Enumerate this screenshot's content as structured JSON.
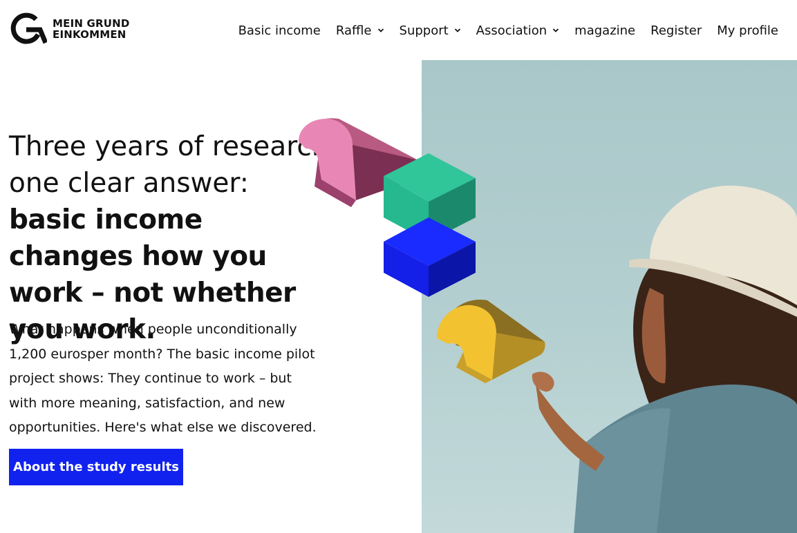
{
  "brand": {
    "line1": "MEIN GRUND",
    "line2": "EINKOMMEN"
  },
  "nav": {
    "items": [
      {
        "label": "Basic income",
        "dropdown": false
      },
      {
        "label": "Raffle",
        "dropdown": true
      },
      {
        "label": "Support",
        "dropdown": true
      },
      {
        "label": "Association",
        "dropdown": true
      },
      {
        "label": "magazine",
        "dropdown": false
      },
      {
        "label": "Register",
        "dropdown": false
      },
      {
        "label": "My profile",
        "dropdown": false
      }
    ]
  },
  "hero": {
    "title_line1": "Three years of research,",
    "title_line2": "one clear answer:",
    "title_bold": "basic income changes how you work – not whether you work.",
    "description": "What happens when people unconditionally 1,200 eurosper month? The basic income pilot project shows: They continue to work – but with more meaning, satisfaction, and new opportunities. Here's what else we discovered.",
    "cta_label": "About the study results"
  },
  "colors": {
    "accent": "#1122ee",
    "shape_pink": "#e887b6",
    "shape_green": "#26b88f",
    "shape_blue": "#1420e8",
    "shape_yellow": "#f2c230"
  },
  "icons": {
    "chevron": "chevron-down-icon",
    "logo": "logo-g-icon"
  }
}
